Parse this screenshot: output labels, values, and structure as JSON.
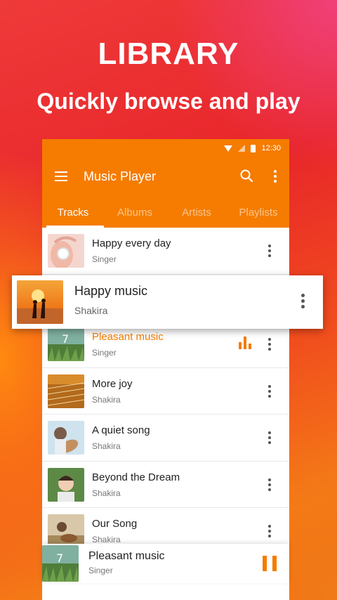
{
  "promo": {
    "title": "LIBRARY",
    "subtitle": "Quickly browse and play"
  },
  "status_bar": {
    "time": "12:30"
  },
  "app": {
    "title": "Music Player",
    "accent": "#f57c00",
    "tabs": [
      "Tracks",
      "Albums",
      "Artists",
      "Playlists"
    ],
    "active_tab": "Tracks"
  },
  "tracks": [
    {
      "name": "Happy every day",
      "artist": "Singer",
      "icon": "headphones-girl-thumb"
    },
    {
      "name": "Pleasant music",
      "artist": "Singer",
      "icon": "grass-field-thumb",
      "playing": true
    },
    {
      "name": "More joy",
      "artist": "Shakira",
      "icon": "guitar-strings-thumb"
    },
    {
      "name": "A quiet song",
      "artist": "Shakira",
      "icon": "guitar-player-thumb"
    },
    {
      "name": "Beyond the Dream",
      "artist": "Shakira",
      "icon": "child-portrait-thumb"
    },
    {
      "name": "Our Song",
      "artist": "Shakira",
      "icon": "girl-guitar-thumb"
    }
  ],
  "dragged_track": {
    "name": "Happy music",
    "artist": "Shakira",
    "icon": "sunset-couple-thumb"
  },
  "now_playing": {
    "name": "Pleasant music",
    "artist": "Singer",
    "state": "playing"
  }
}
